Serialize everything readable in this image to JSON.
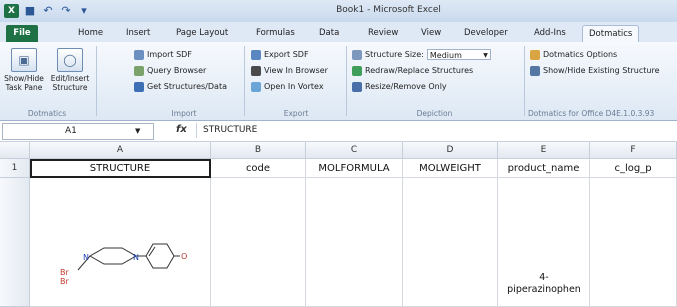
{
  "window": {
    "title": "Book1 - Microsoft Excel",
    "app_icon": "excel-icon",
    "quick_access": [
      "save-icon",
      "undo-icon",
      "redo-icon",
      "customize-icon"
    ]
  },
  "tabs": [
    "File",
    "Home",
    "Insert",
    "Page Layout",
    "Formulas",
    "Data",
    "Review",
    "View",
    "Developer",
    "Add-Ins",
    "Dotmatics"
  ],
  "active_tab": "Dotmatics",
  "ribbon": {
    "dotmatics_group": {
      "label": "Dotmatics",
      "show_hide": "Show/Hide\nTask Pane",
      "edit_insert": "Edit/Insert\nStructure"
    },
    "import_group": {
      "label": "Import",
      "items": [
        "Import SDF",
        "Query Browser",
        "Get Structures/Data"
      ]
    },
    "export_group": {
      "label": "Export",
      "items": [
        "Export SDF",
        "View In Browser",
        "Open In Vortex"
      ]
    },
    "depiction_group": {
      "label": "Depiction",
      "structure_size_label": "Structure Size:",
      "structure_size_value": "Medium",
      "items": [
        "Redraw/Replace Structures",
        "Resize/Remove Only"
      ]
    },
    "office_group": {
      "label": "Dotmatics for Office D4E.1.0.3.93",
      "items": [
        "Dotmatics Options",
        "Show/Hide Existing Structure"
      ]
    }
  },
  "formula_bar": {
    "name_box": "A1",
    "fx": "fx",
    "value": "STRUCTURE"
  },
  "sheet": {
    "columns": [
      "A",
      "B",
      "C",
      "D",
      "E",
      "F"
    ],
    "rows": [
      "1"
    ],
    "row1": [
      "STRUCTURE",
      "code",
      "MOLFORMULA",
      "MOLWEIGHT",
      "product_name",
      "c_log_p"
    ],
    "row2_product_name_partial": "4-\npiperazinophen",
    "structure_atoms": [
      "N",
      "N",
      "O",
      "Br",
      "Br"
    ]
  },
  "colors": {
    "excel_green": "#1e7145",
    "ribbon_blue": "#dde8f4",
    "bromine_red": "#c0392b",
    "nitrogen_blue": "#1f3fbf"
  }
}
